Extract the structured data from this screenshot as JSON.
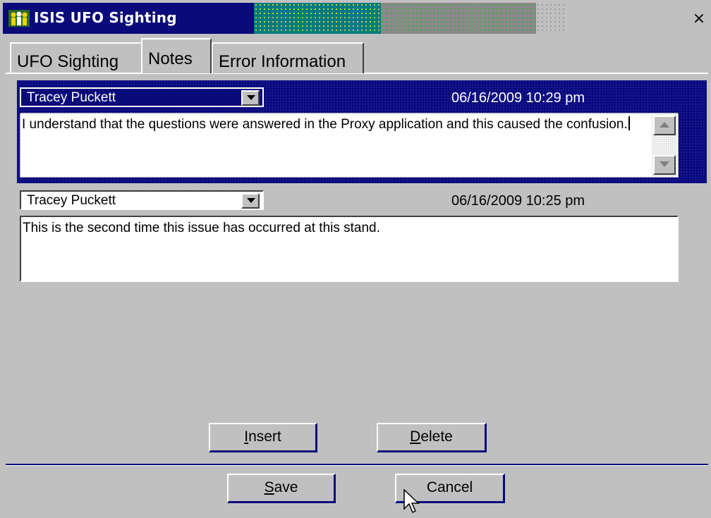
{
  "window": {
    "title": "ISIS UFO Sighting",
    "close_label": "×",
    "icon": "app-people-icon"
  },
  "tabs": [
    {
      "label": "UFO Sighting",
      "active": false
    },
    {
      "label": "Notes",
      "active": true
    },
    {
      "label": "Error Information",
      "active": false
    }
  ],
  "notes": [
    {
      "author": "Tracey Puckett",
      "timestamp": "06/16/2009 10:29 pm",
      "text": "I understand that the questions were answered in the Proxy application and this caused the confusion.",
      "selected": true
    },
    {
      "author": "Tracey Puckett",
      "timestamp": "06/16/2009 10:25 pm",
      "text": "This is the second time this issue has occurred at this stand.",
      "selected": false
    }
  ],
  "buttons": {
    "insert": {
      "prefix": "",
      "mnemonic": "I",
      "rest": "nsert"
    },
    "delete": {
      "prefix": "",
      "mnemonic": "D",
      "rest": "elete"
    },
    "save": {
      "prefix": "",
      "mnemonic": "S",
      "rest": "ave"
    },
    "cancel": {
      "label": "Cancel"
    }
  },
  "colors": {
    "titlebar": "#0a0a7a",
    "face": "#c0c0c0",
    "selection": "#0a0a7a"
  }
}
